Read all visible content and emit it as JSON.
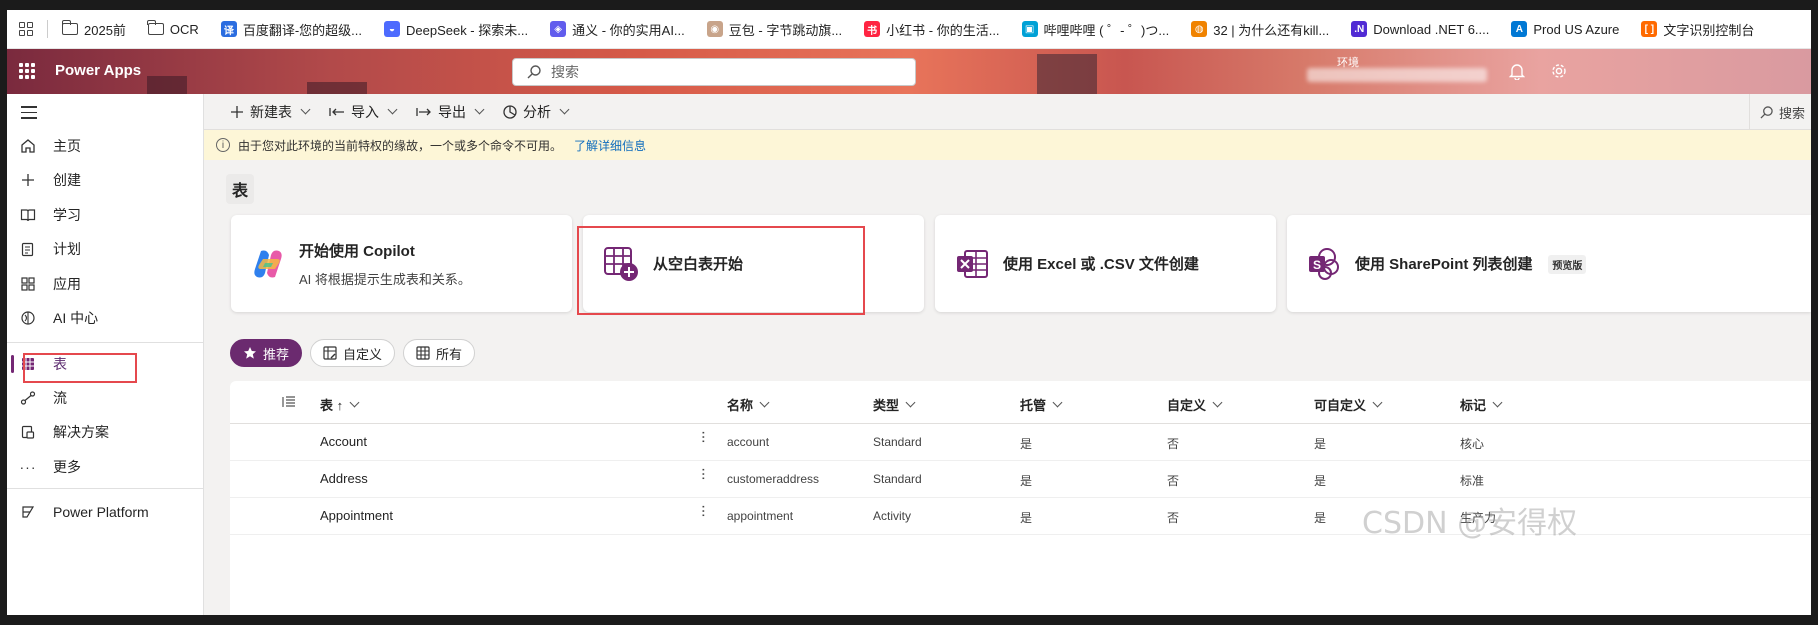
{
  "bookmarks": [
    {
      "label": "2025前",
      "icon": "folder-icon",
      "color": ""
    },
    {
      "label": "OCR",
      "icon": "folder-icon",
      "color": ""
    },
    {
      "label": "百度翻译-您的超级...",
      "icon": "baidu-translate-icon",
      "color": "#2b6de0",
      "glyph": "译"
    },
    {
      "label": "DeepSeek - 探索未...",
      "icon": "deepseek-icon",
      "color": "#4d6bfe",
      "glyph": "◒"
    },
    {
      "label": "通义 - 你的实用AI...",
      "icon": "tongyi-icon",
      "color": "#615ced",
      "glyph": "◈"
    },
    {
      "label": "豆包 - 字节跳动旗...",
      "icon": "doubao-icon",
      "color": "#c8a48a",
      "glyph": "◉"
    },
    {
      "label": "小红书 - 你的生活...",
      "icon": "xiaohongshu-icon",
      "color": "#ff2442",
      "glyph": "书"
    },
    {
      "label": "哔哩哔哩 ( ゜- ゜)つ...",
      "icon": "bilibili-icon",
      "color": "#00a1d6",
      "glyph": "▣"
    },
    {
      "label": "32 | 为什么还有kill...",
      "icon": "geekbang-icon",
      "color": "#f08300",
      "glyph": "◍"
    },
    {
      "label": "Download .NET 6....",
      "icon": "dotnet-icon",
      "color": "#512bd4",
      "glyph": ".N"
    },
    {
      "label": "Prod US Azure",
      "icon": "azure-icon",
      "color": "#0078d4",
      "glyph": "A"
    },
    {
      "label": "文字识别控制台",
      "icon": "console-icon",
      "color": "#ff6a00",
      "glyph": "[ ]"
    }
  ],
  "header": {
    "app_name": "Power Apps",
    "search_placeholder": "搜索",
    "env_label": "环境"
  },
  "nav": {
    "items": [
      {
        "label": "主页",
        "icon": "home-icon"
      },
      {
        "label": "创建",
        "icon": "plus-icon"
      },
      {
        "label": "学习",
        "icon": "book-icon"
      },
      {
        "label": "计划",
        "icon": "plan-icon"
      },
      {
        "label": "应用",
        "icon": "apps-icon"
      },
      {
        "label": "AI 中心",
        "icon": "ai-hub-icon"
      }
    ],
    "items2": [
      {
        "label": "表",
        "icon": "table-icon",
        "active": true
      },
      {
        "label": "流",
        "icon": "flow-icon"
      },
      {
        "label": "解决方案",
        "icon": "solution-icon"
      },
      {
        "label": "更多",
        "icon": "more-icon"
      }
    ],
    "footer": {
      "label": "Power Platform",
      "icon": "power-platform-icon"
    }
  },
  "commands": {
    "new_table": "新建表",
    "import": "导入",
    "export": "导出",
    "analyze": "分析",
    "search": "搜索"
  },
  "banner": {
    "text": "由于您对此环境的当前特权的缘故，一个或多个命令不可用。",
    "link": "了解详细信息"
  },
  "page_title": "表",
  "cards": [
    {
      "title": "开始使用 Copilot",
      "subtitle": "AI 将根据提示生成表和关系。",
      "icon": "copilot-icon"
    },
    {
      "title": "从空白表开始",
      "subtitle": "",
      "icon": "blank-table-icon"
    },
    {
      "title": "使用 Excel 或 .CSV 文件创建",
      "subtitle": "",
      "icon": "excel-icon"
    },
    {
      "title": "使用 SharePoint 列表创建",
      "subtitle": "",
      "icon": "sharepoint-icon",
      "badge": "预览版"
    }
  ],
  "filters": [
    {
      "label": "推荐",
      "icon": "star-icon",
      "selected": true
    },
    {
      "label": "自定义",
      "icon": "custom-table-icon",
      "selected": false
    },
    {
      "label": "所有",
      "icon": "grid-icon",
      "selected": false
    }
  ],
  "grid": {
    "columns": [
      "表 ↑",
      "名称",
      "类型",
      "托管",
      "自定义",
      "可自定义",
      "标记"
    ],
    "rows": [
      {
        "table": "Account",
        "name": "account",
        "type": "Standard",
        "managed": "是",
        "custom": "否",
        "customizable": "是",
        "tag": "核心"
      },
      {
        "table": "Address",
        "name": "customeraddress",
        "type": "Standard",
        "managed": "是",
        "custom": "否",
        "customizable": "是",
        "tag": "标准"
      },
      {
        "table": "Appointment",
        "name": "appointment",
        "type": "Activity",
        "managed": "是",
        "custom": "否",
        "customizable": "是",
        "tag": "生产力"
      }
    ]
  },
  "watermark": "CSDN @安得权",
  "colors": {
    "accent": "#742774",
    "highlight_box": "#e5484d",
    "banner_bg": "#fdf6d7"
  }
}
